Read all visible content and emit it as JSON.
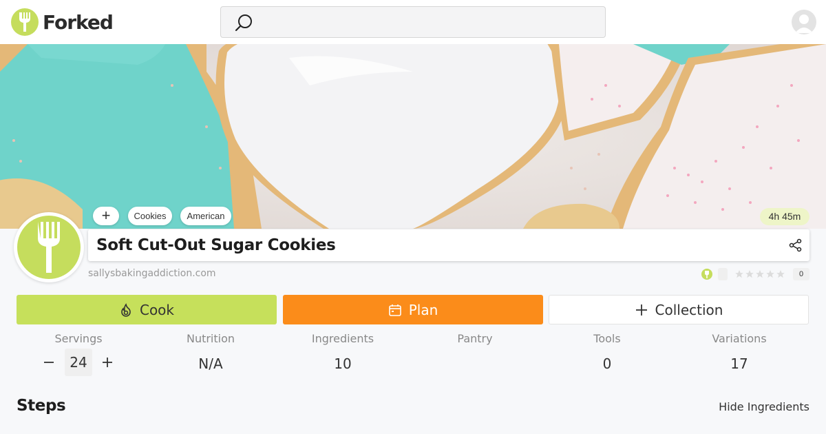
{
  "app": {
    "name": "Forked"
  },
  "search": {
    "placeholder": ""
  },
  "recipe": {
    "title": "Soft Cut-Out Sugar Cookies",
    "source": "sallysbakingaddiction.com",
    "tags": [
      "Cookies",
      "American"
    ],
    "add_tag_label": "+",
    "total_time": "4h 45m",
    "rating_count": "0",
    "rating_stars": 0
  },
  "actions": {
    "cook": "Cook",
    "plan": "Plan",
    "collection": "Collection"
  },
  "stats": {
    "servings": {
      "label": "Servings",
      "value": "24"
    },
    "nutrition": {
      "label": "Nutrition",
      "value": "N/A"
    },
    "ingredients": {
      "label": "Ingredients",
      "value": "10"
    },
    "pantry": {
      "label": "Pantry",
      "value": ""
    },
    "tools": {
      "label": "Tools",
      "value": "0"
    },
    "variations": {
      "label": "Variations",
      "value": "17"
    }
  },
  "section": {
    "steps_title": "Steps",
    "hide_ingredients": "Hide Ingredients"
  },
  "colors": {
    "accent_green": "#c6e05b",
    "accent_orange": "#fb8c1a",
    "hero_teal": "#68cfc6",
    "hero_icing": "#f4f4f6"
  },
  "icons": {
    "logo": "fork-icon",
    "search": "search-icon",
    "share": "share-icon",
    "cook": "flame-icon",
    "plan": "calendar-icon",
    "collection": "plus-icon"
  }
}
